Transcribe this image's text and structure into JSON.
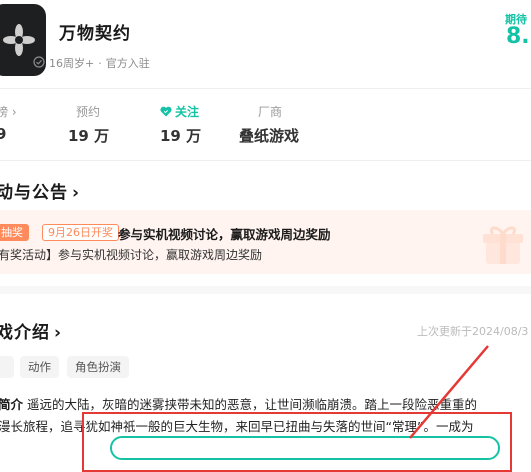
{
  "app": {
    "title": "万物契约",
    "age_rating": "16周岁+",
    "separator": "·",
    "official": "官方入驻",
    "expect_label": "期待",
    "expect_score": "8."
  },
  "stats": [
    {
      "label": "榜",
      "arrow": "›",
      "value": "9"
    },
    {
      "label": "预约",
      "value": "19 万"
    },
    {
      "label": "关注",
      "value": "19 万"
    },
    {
      "label": "厂商",
      "value": "叠纸游戏"
    }
  ],
  "activity": {
    "section_title": "动与公告",
    "chevron": "›",
    "lottery_tag": "抽奖",
    "date_tag": "9月26日开奖",
    "title": "参与实机视频讨论，赢取游戏周边奖励",
    "subtitle": "有奖活动】参与实机视频讨论，赢取游戏周边奖励"
  },
  "intro": {
    "section_title": "戏介绍",
    "chevron": "›",
    "updated": "上次更新于2024/08/3",
    "tags": [
      "",
      "动作",
      "角色扮演"
    ],
    "label": "简介",
    "line1": "遥远的大陆，灰暗的迷雾挟带未知的恶意，让世间濒临崩溃。踏上一段险恶重重的",
    "line2": "漫长旅程，追寻犹如神祇一般的巨大生物，来回早已扭曲与失落的世间“常理”。一成为"
  },
  "colors": {
    "accent": "#14c3a5",
    "activity_orange": "#ff8a5b",
    "annotation_red": "#e53935"
  },
  "icons": {
    "app": "flower-emblem-icon",
    "official": "verified-check-icon",
    "follow": "heart-icon",
    "gift": "gift-box-icon"
  }
}
